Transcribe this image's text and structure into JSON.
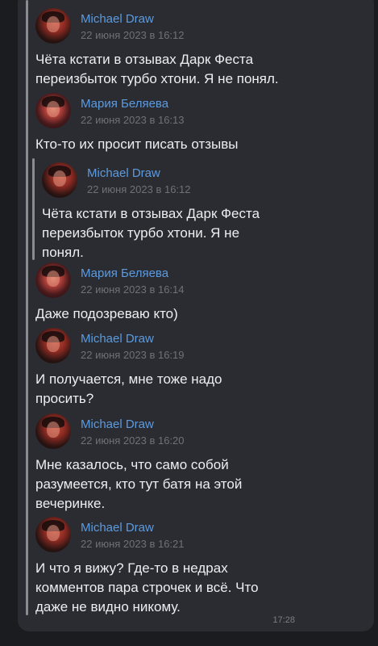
{
  "messages": [
    {
      "author": "Michael Draw",
      "date": "22 июня 2023 в 16:12",
      "text": "Чёта кстати в отзывах Дарк Феста\nпереизбыток турбо хтони. Я не понял.",
      "avatar": "michael"
    },
    {
      "author": "Мария Беляева",
      "date": "22 июня 2023 в 16:13",
      "text": "Кто-то их просит писать отзывы",
      "avatar": "maria"
    },
    {
      "author": "Michael Draw",
      "date": "22 июня 2023 в 16:12",
      "text": "Чёта кстати в отзывах Дарк Феста\nпереизбыток турбо хтони. Я не\nпонял.",
      "avatar": "michael",
      "nested": true
    },
    {
      "author": "Мария Беляева",
      "date": "22 июня 2023 в 16:14",
      "text": "Даже подозреваю кто)",
      "avatar": "maria"
    },
    {
      "author": "Michael Draw",
      "date": "22 июня 2023 в 16:19",
      "text": "И получается, мне тоже надо\nпросить?",
      "avatar": "michael"
    },
    {
      "author": "Michael Draw",
      "date": "22 июня 2023 в 16:20",
      "text": "Мне казалось, что само собой\nразумеется, кто тут батя на этой\nвечеринке.",
      "avatar": "michael"
    },
    {
      "author": "Michael Draw",
      "date": "22 июня 2023 в 16:21",
      "text": "И что я вижу? Где-то в недрах\nкомментов пара строчек и всё. Что\nдаже не видно никому.",
      "avatar": "michael"
    }
  ],
  "message_time": "17:28",
  "colors": {
    "background": "#1b1c1f",
    "bubble": "#2b2c31",
    "author": "#5b9be0",
    "date": "#6f7177",
    "text": "#eceef1"
  }
}
